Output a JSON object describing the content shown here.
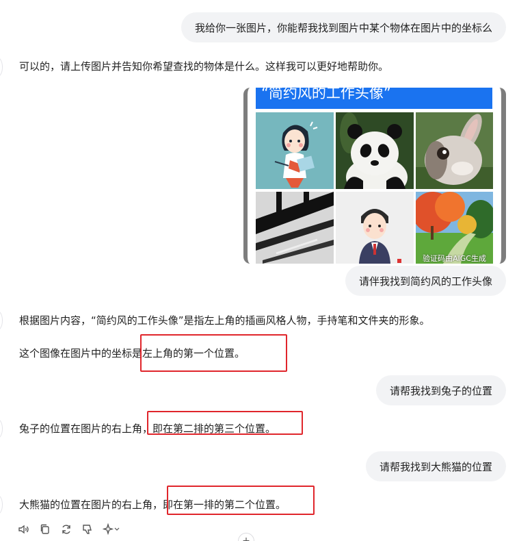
{
  "messages": {
    "user_1": "我给你一张图片，你能帮我找到图片中某个物体在图片中的坐标么",
    "bot_1": "可以的，请上传图片并告知你希望查找的物体是什么。这样我可以更好地帮助你。",
    "user_2": "请伴我找到简约风的工作头像",
    "bot_2_line1": "根据图片内容，“简约风的工作头像”是指左上角的插画风格人物，手持笔和文件夹的形象。",
    "bot_2_line2": "这个图像在图片中的坐标是左上角的第一个位置。",
    "user_3": "请帮我找到兔子的位置",
    "bot_3": "兔子的位置在图片的右上角，即在第二排的第三个位置。",
    "user_4": "请帮我找到大熊猫的位置",
    "bot_4": "大熊猫的位置在图片的右上角，即在第一排的第二个位置。"
  },
  "uploaded_image": {
    "banner_text": "“简约风的工作头像”",
    "watermark": "验证码由AIGC生成",
    "tiles": [
      "illustrated-person",
      "panda",
      "rabbit",
      "black-white-lines",
      "cartoon-avatar",
      "autumn-park"
    ]
  },
  "toolbar": {
    "icons": [
      "speaker-icon",
      "copy-icon",
      "regenerate-icon",
      "dislike-icon",
      "sparkle-icon"
    ]
  },
  "colors": {
    "user_bubble_bg": "#f2f3f5",
    "highlight_box": "#e0252b",
    "banner_blue": "#1a73f0"
  }
}
